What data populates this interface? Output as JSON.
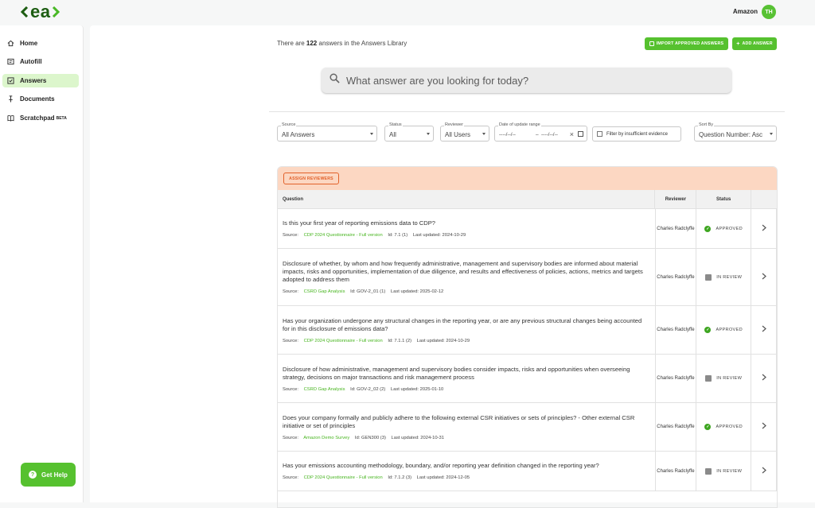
{
  "brand": {
    "logo_text": "ea",
    "accent": "#56c12f",
    "logo_color": "#1d5d12"
  },
  "header": {
    "org_name": "Amazon",
    "avatar_initials": "TH"
  },
  "sidebar": {
    "items": [
      {
        "label": "Home",
        "icon": "home-icon"
      },
      {
        "label": "Autofill",
        "icon": "autofill-icon"
      },
      {
        "label": "Answers",
        "icon": "answers-icon",
        "active": true
      },
      {
        "label": "Documents",
        "icon": "pin-icon"
      },
      {
        "label": "Scratchpad",
        "icon": "book-icon",
        "badge": "BETA"
      }
    ],
    "help_label": "Get Help"
  },
  "main": {
    "count_prefix": "There are ",
    "count_value": "122",
    "count_suffix": " answers in the Answers Library",
    "import_label": "IMPORT APPROVED ANSWERS",
    "add_label": "ADD ANSWER",
    "search_placeholder": "What answer are you looking for today?"
  },
  "filters": {
    "source": {
      "label": "Source",
      "value": "All Answers"
    },
    "status": {
      "label": "Status",
      "value": "All"
    },
    "reviewer": {
      "label": "Reviewer",
      "value": "All Users"
    },
    "date": {
      "label": "Date of update range",
      "from": "----/--/--",
      "to": "----/--/--"
    },
    "insufficient": "Filter by insufficient evidence",
    "sort": {
      "label": "Sort By",
      "value": "Question Number: Asc"
    }
  },
  "table": {
    "assign_label": "ASSIGN REVIEWERS",
    "headers": {
      "question": "Question",
      "reviewer": "Reviewer",
      "status": "Status"
    },
    "rows": [
      {
        "question": "Is this your first year of reporting emissions data to CDP?",
        "source_label": "Source:",
        "source": "CDP 2024 Questionnaire - Full version",
        "id": "Id:  7.1 (1)",
        "updated": "Last updated: 2024-10-29",
        "reviewer": "Charles Radclyffe",
        "status": "APPROVED"
      },
      {
        "question": "Disclosure of whether, by whom and how frequently administrative, management and supervisory bodies are informed about material impacts, risks and opportunities, implementation of due diligence, and results and effectiveness of policies, actions, metrics and targets adopted to address them",
        "source_label": "Source:",
        "source": "CSRD Gap Analysis",
        "id": "Id:  GOV-2_01 (1)",
        "updated": "Last updated: 2025-02-12",
        "reviewer": "Charles Radclyffe",
        "status": "IN REVIEW"
      },
      {
        "question": "Has your organization undergone any structural changes in the reporting year, or are any previous structural changes being accounted for in this disclosure of emissions data?",
        "source_label": "Source:",
        "source": "CDP 2024 Questionnaire - Full version",
        "id": "Id:  7.1.1 (2)",
        "updated": "Last updated: 2024-10-29",
        "reviewer": "Charles Radclyffe",
        "status": "APPROVED"
      },
      {
        "question": "Disclosure of how administrative, management and supervisory bodies consider impacts, risks and opportunities when overseeing strategy, decisions on major transactions and risk management process",
        "source_label": "Source:",
        "source": "CSRD Gap Analysis",
        "id": "Id:  GOV-2_02 (2)",
        "updated": "Last updated: 2025-01-10",
        "reviewer": "Charles Radclyffe",
        "status": "IN REVIEW"
      },
      {
        "question": "Does your company formally and publicly adhere to the following external CSR initiatives or sets of principles? - Other external CSR initiative or set of principles",
        "source_label": "Source:",
        "source": "Amazon Demo Survey",
        "id": "Id:  GEN300 (3)",
        "updated": "Last updated: 2024-10-31",
        "reviewer": "Charles Radclyffe",
        "status": "APPROVED"
      },
      {
        "question": "Has your emissions accounting methodology, boundary, and/or reporting year definition changed in the reporting year?",
        "source_label": "Source:",
        "source": "CDP 2024 Questionnaire - Full version",
        "id": "Id:  7.1.2 (3)",
        "updated": "Last updated: 2024-12-05",
        "reviewer": "Charles Radclyffe",
        "status": "IN REVIEW"
      }
    ]
  }
}
